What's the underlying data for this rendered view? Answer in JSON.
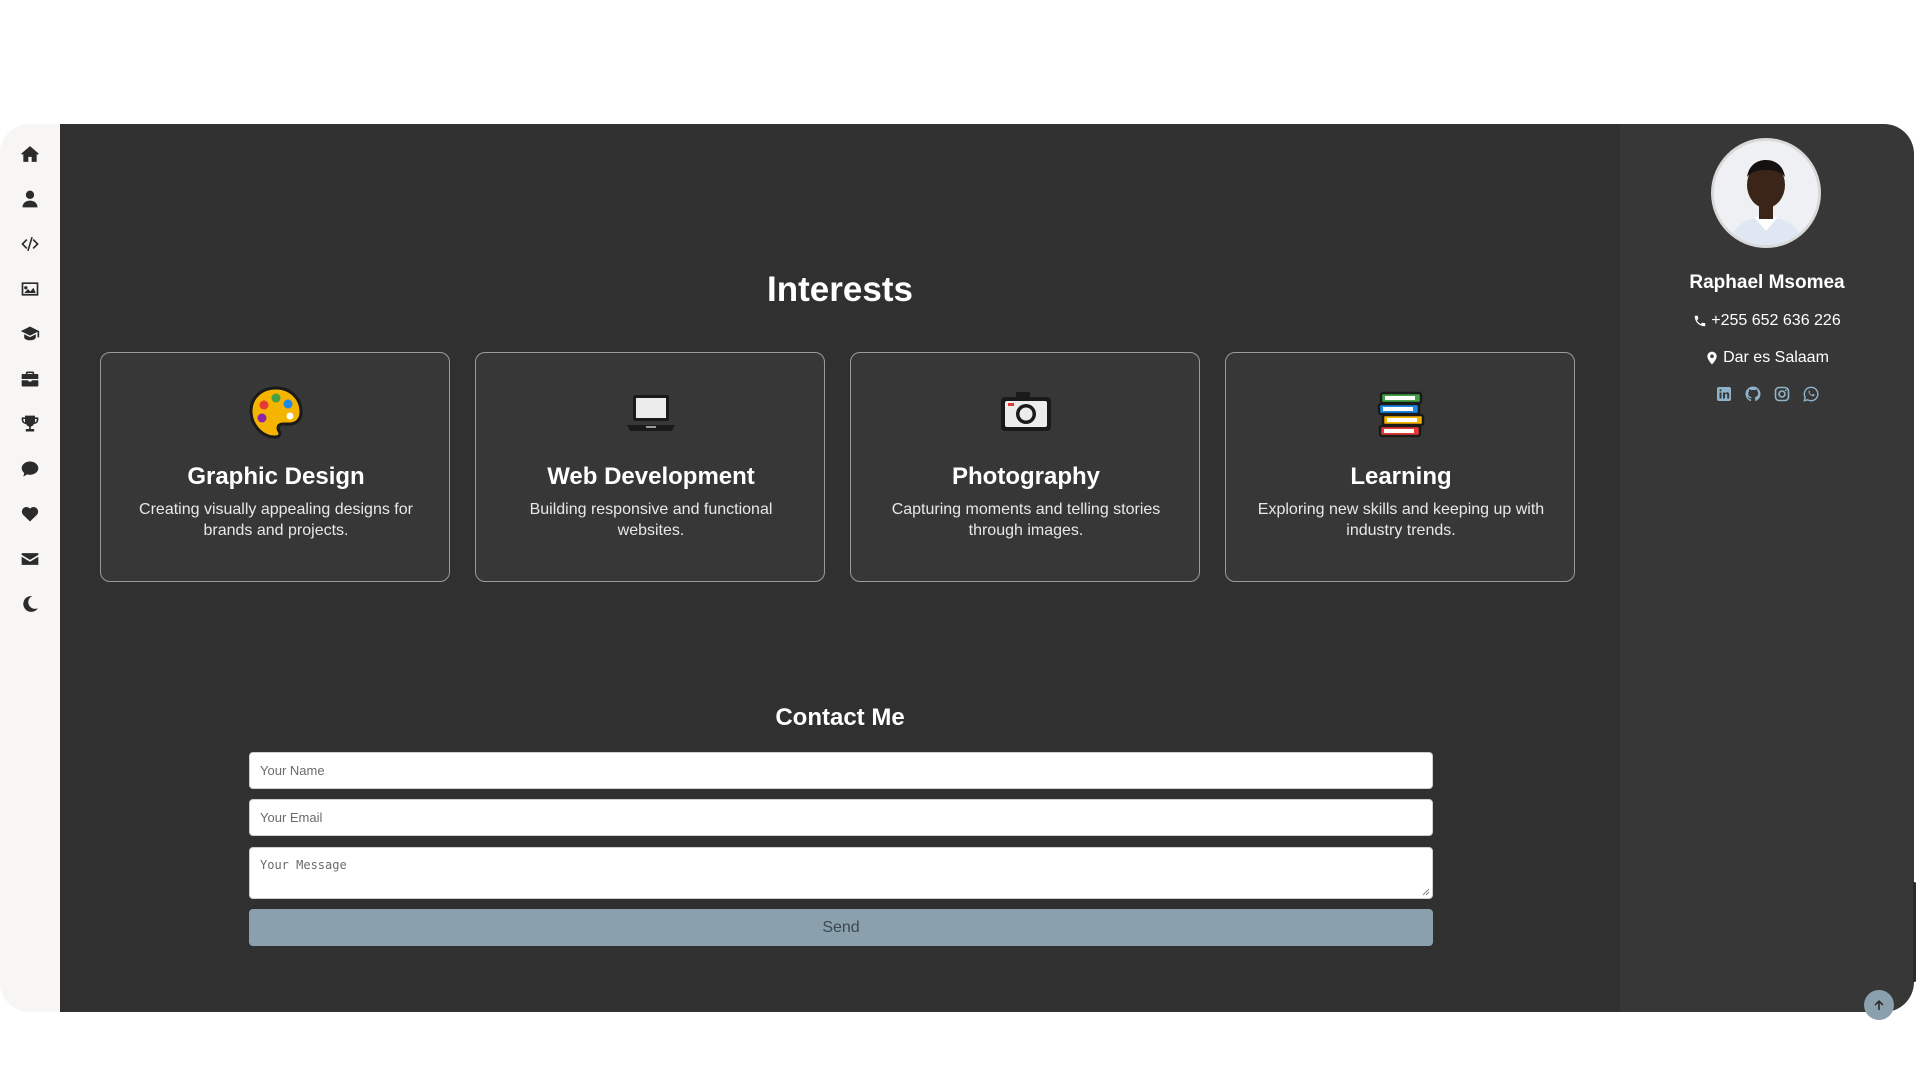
{
  "nav": {
    "items": [
      {
        "icon": "home-icon"
      },
      {
        "icon": "user-icon"
      },
      {
        "icon": "code-icon"
      },
      {
        "icon": "image-icon"
      },
      {
        "icon": "graduation-cap-icon"
      },
      {
        "icon": "briefcase-icon"
      },
      {
        "icon": "trophy-icon"
      },
      {
        "icon": "comment-icon"
      },
      {
        "icon": "heart-icon"
      },
      {
        "icon": "envelope-icon"
      },
      {
        "icon": "moon-icon"
      }
    ]
  },
  "interests": {
    "title": "Interests",
    "cards": [
      {
        "icon": "palette-icon",
        "title": "Graphic Design",
        "description": "Creating visually appealing designs for brands and projects."
      },
      {
        "icon": "laptop-icon",
        "title": "Web Development",
        "description": "Building responsive and functional websites."
      },
      {
        "icon": "camera-icon",
        "title": "Photography",
        "description": "Capturing moments and telling stories through images."
      },
      {
        "icon": "books-icon",
        "title": "Learning",
        "description": "Exploring new skills and keeping up with industry trends."
      }
    ]
  },
  "contact": {
    "title": "Contact Me",
    "name_placeholder": "Your Name",
    "email_placeholder": "Your Email",
    "message_placeholder": "Your Message",
    "send_label": "Send"
  },
  "profile": {
    "name": "Raphael Msomea",
    "phone": "+255 652 636 226",
    "location": "Dar es Salaam",
    "socials": [
      "linkedin-icon",
      "github-icon",
      "instagram-icon",
      "whatsapp-icon"
    ]
  },
  "colors": {
    "main_bg": "#303030",
    "profile_bg": "#373737",
    "nav_bg": "#f7f6f4",
    "button": "#8aa0ad",
    "social_icon": "#8fb3c9"
  }
}
